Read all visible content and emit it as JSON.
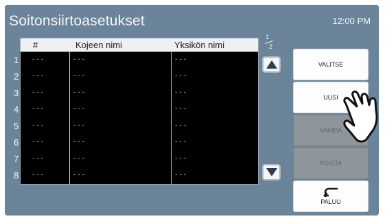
{
  "screen": {
    "title": "Soitonsiirtoasetukset",
    "time": "12:00 PM"
  },
  "table": {
    "headers": {
      "num": "#",
      "device_name": "Kojeen nimi",
      "unit_name": "Yksikön nimi"
    },
    "row_numbers": [
      "1",
      "2",
      "3",
      "4",
      "5",
      "6",
      "7",
      "8"
    ],
    "rows": [
      [
        "---",
        "---",
        "---"
      ],
      [
        "---",
        "---",
        "---"
      ],
      [
        "---",
        "---",
        "---"
      ],
      [
        "---",
        "---",
        "---"
      ],
      [
        "---",
        "---",
        "---"
      ],
      [
        "---",
        "---",
        "---"
      ],
      [
        "---",
        "---",
        "---"
      ],
      [
        "---",
        "---",
        "---"
      ]
    ]
  },
  "pagination": {
    "current": "1",
    "total": "2"
  },
  "buttons": {
    "select": "VALITSE",
    "new": "UUSI",
    "change": "VAIHDA",
    "delete": "POISTA",
    "back": "PALUU"
  },
  "colors": {
    "background": "#6c849a",
    "table_body": "#000000",
    "disabled_button": "#8e959b"
  },
  "icons": [
    "scroll-up-icon",
    "scroll-down-icon",
    "back-arrow-icon",
    "pointing-hand-icon"
  ]
}
